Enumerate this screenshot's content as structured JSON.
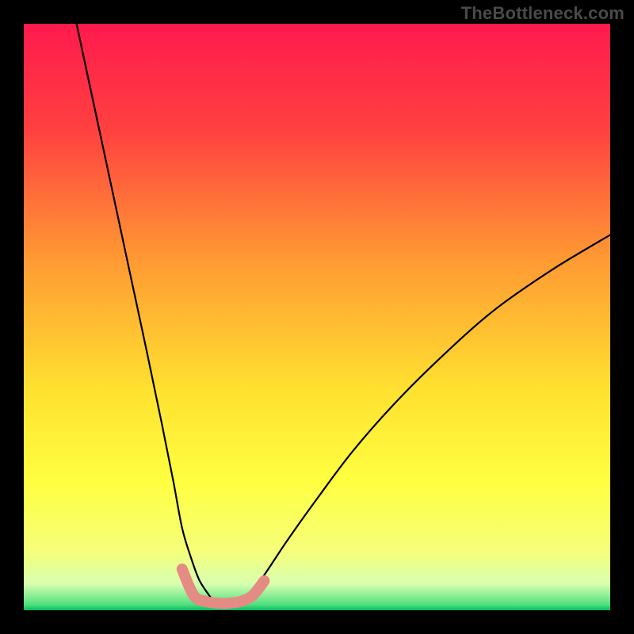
{
  "attribution": "TheBottleneck.com",
  "chart_data": {
    "type": "line",
    "title": "",
    "xlabel": "",
    "ylabel": "",
    "xlim": [
      0,
      100
    ],
    "ylim": [
      0,
      100
    ],
    "grid": false,
    "background_gradient": {
      "stops": [
        {
          "offset": 0,
          "color": "#ff1a4d"
        },
        {
          "offset": 0.18,
          "color": "#ff4040"
        },
        {
          "offset": 0.4,
          "color": "#ff9933"
        },
        {
          "offset": 0.62,
          "color": "#ffe030"
        },
        {
          "offset": 0.78,
          "color": "#ffff40"
        },
        {
          "offset": 0.9,
          "color": "#f5ff7a"
        },
        {
          "offset": 0.955,
          "color": "#d8ffb0"
        },
        {
          "offset": 0.99,
          "color": "#55e080"
        },
        {
          "offset": 1.0,
          "color": "#00c060"
        }
      ]
    },
    "series": [
      {
        "name": "bottleneck-curve-left",
        "color": "#000000",
        "x": [
          9,
          12,
          15,
          18,
          21,
          23.5,
          25.5,
          27,
          28.5,
          30,
          32
        ],
        "y": [
          100,
          86,
          72,
          58,
          44,
          32,
          22,
          14,
          9,
          5,
          2
        ]
      },
      {
        "name": "bottleneck-curve-right",
        "color": "#000000",
        "x": [
          38,
          41,
          45,
          50,
          56,
          63,
          71,
          80,
          90,
          100
        ],
        "y": [
          2,
          6,
          12,
          19,
          27,
          35,
          43,
          51,
          58,
          64
        ]
      }
    ],
    "floor_band": {
      "name": "minimum-band",
      "color": "#e48b83",
      "thickness_px": 14,
      "x": [
        27,
        29,
        31,
        33,
        35,
        37,
        39,
        41
      ],
      "y": [
        7,
        2.5,
        1.5,
        1.2,
        1.2,
        1.5,
        2.5,
        5
      ]
    }
  }
}
